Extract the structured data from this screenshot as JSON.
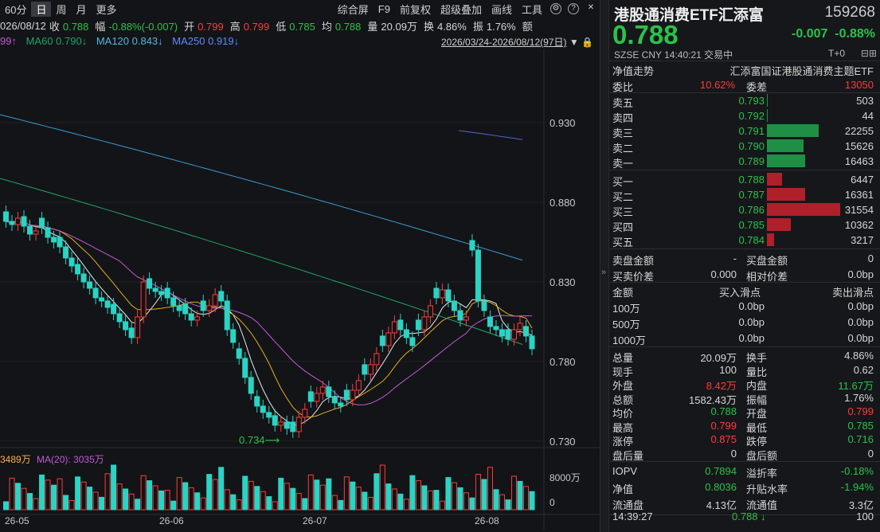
{
  "toolbar": {
    "period": "60分",
    "day": "日",
    "week": "周",
    "month": "月",
    "more": "更多",
    "right_items": [
      "综合屏",
      "F9",
      "前复权",
      "超级叠加",
      "画线",
      "工具"
    ]
  },
  "info": {
    "date": "026/08/12",
    "close_label": "收",
    "close": "0.788",
    "amp_label": "幅",
    "amp": "-0.88%(-0.007)",
    "open_label": "开",
    "open": "0.799",
    "high_label": "高",
    "high": "0.799",
    "low_label": "低",
    "low": "0.785",
    "avg_label": "均",
    "avg": "0.788",
    "vol_label": "量",
    "vol": "20.09万",
    "turn_label": "换",
    "turn": "4.86%",
    "swing_label": "振",
    "swing": "1.76%",
    "amt_label": "额"
  },
  "ma": {
    "ma_prev": "99↑",
    "ma60": "MA60 0.790↓",
    "ma120": "MA120 0.843↓",
    "ma250": "MA250 0.919↓",
    "range": "2026/03/24-2026/08/12(97日)"
  },
  "yaxis": [
    "0.930",
    "0.880",
    "0.830",
    "0.780",
    "0.730"
  ],
  "annot_low": "0.734⟶",
  "vol_info": {
    "v1": "3489万",
    "v2": "MA(20): 3035万",
    "y_top": "8000万",
    "y_zero": "0"
  },
  "xaxis": [
    "26-05",
    "26-06",
    "26-07",
    "26-08"
  ],
  "colors": {
    "up": "#ff3b3b",
    "down": "#2ad4c4",
    "bg": "#131417"
  },
  "quote": {
    "name": "港股通消费ETF汇添富",
    "code": "159268",
    "price": "0.788",
    "chg": "-0.007",
    "chg_pct": "-0.88%",
    "sub_left": "SZSE  CNY  14:40:21  交易中",
    "sub_right": "T+0"
  },
  "nav_row": {
    "label": "净值走势",
    "value": "汇添富国证港股通消费主题ETF"
  },
  "wei": {
    "wb_label": "委比",
    "wb": "10.62%",
    "wc_label": "委差",
    "wc": "13050"
  },
  "asks": [
    {
      "label": "卖五",
      "price": "0.793",
      "vol": "503",
      "ratio": 0.016
    },
    {
      "label": "卖四",
      "price": "0.792",
      "vol": "44",
      "ratio": 0.001
    },
    {
      "label": "卖三",
      "price": "0.791",
      "vol": "22255",
      "ratio": 0.705
    },
    {
      "label": "卖二",
      "price": "0.790",
      "vol": "15626",
      "ratio": 0.495
    },
    {
      "label": "卖一",
      "price": "0.789",
      "vol": "16463",
      "ratio": 0.522
    }
  ],
  "bids": [
    {
      "label": "买一",
      "price": "0.788",
      "vol": "6447",
      "ratio": 0.204
    },
    {
      "label": "买二",
      "price": "0.787",
      "vol": "16361",
      "ratio": 0.518
    },
    {
      "label": "买三",
      "price": "0.786",
      "vol": "31554",
      "ratio": 1.0
    },
    {
      "label": "买四",
      "price": "0.785",
      "vol": "10362",
      "ratio": 0.328
    },
    {
      "label": "买五",
      "price": "0.784",
      "vol": "3217",
      "ratio": 0.102
    }
  ],
  "pan": {
    "r1": [
      "卖盘金额",
      "-",
      "买盘金额",
      "0"
    ],
    "r2": [
      "买卖价差",
      "0.000",
      "相对价差",
      "0.0bp"
    ]
  },
  "slip": {
    "h": [
      "金额",
      "买入滑点",
      "卖出滑点"
    ],
    "rows": [
      [
        "100万",
        "0.0bp",
        "0.0bp"
      ],
      [
        "500万",
        "0.0bp",
        "0.0bp"
      ],
      [
        "1000万",
        "0.0bp",
        "0.0bp"
      ]
    ]
  },
  "stats": [
    [
      "总量",
      "20.09万",
      "换手",
      "4.86%"
    ],
    [
      "现手",
      "100",
      "量比",
      "0.62"
    ],
    [
      "外盘",
      "8.42万",
      "内盘",
      "11.67万"
    ],
    [
      "总额",
      "1582.43万",
      "振幅",
      "1.76%"
    ],
    [
      "均价",
      "0.788",
      "开盘",
      "0.799"
    ],
    [
      "最高",
      "0.799",
      "最低",
      "0.785"
    ],
    [
      "涨停",
      "0.875",
      "跌停",
      "0.716"
    ],
    [
      "盘后量",
      "0",
      "盘后额",
      "0"
    ]
  ],
  "stats2": [
    [
      "IOPV",
      "0.7894",
      "溢折率",
      "-0.18%"
    ],
    [
      "净值",
      "0.8036",
      "升贴水率",
      "-1.94%"
    ],
    [
      "流通盘",
      "4.13亿",
      "流通值",
      "3.3亿"
    ]
  ],
  "tick": {
    "time": "14:39:27",
    "price": "0.788",
    "vol": "100"
  }
}
